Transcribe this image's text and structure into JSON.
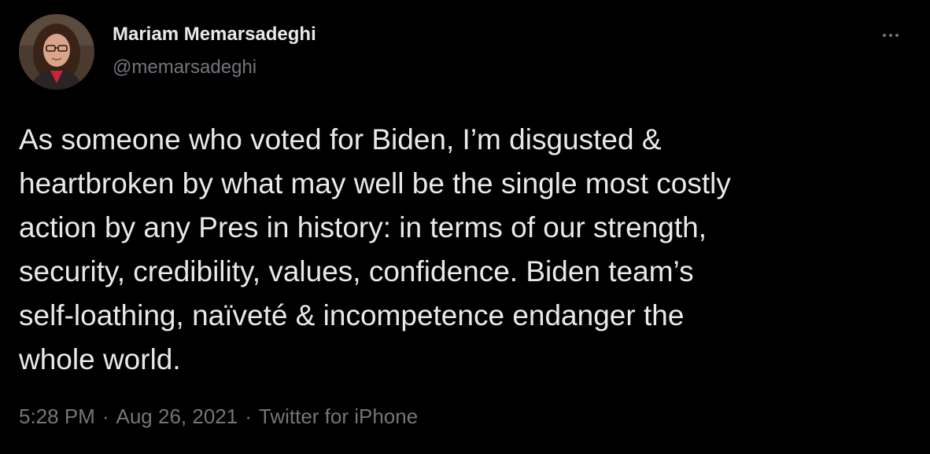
{
  "author": {
    "name": "Mariam Memarsadeghi",
    "handle": "@memarsadeghi"
  },
  "tweet": {
    "lines": [
      "As someone who voted for Biden, I’m disgusted &",
      "heartbroken by what may well be the single most costly",
      "action by any Pres in history: in terms of our strength,",
      "security, credibility, values, confidence. Biden team’s",
      "self-loathing, naïveté & incompetence endanger the",
      "whole world."
    ]
  },
  "meta": {
    "time": "5:28 PM",
    "separator": "·",
    "date": "Aug 26, 2021",
    "source": "Twitter for iPhone"
  },
  "icons": {
    "more": "more-icon",
    "avatar": "avatar-photo"
  },
  "colors": {
    "background": "#000000",
    "primary_text": "#e7e9ea",
    "secondary_text": "#71767b"
  }
}
